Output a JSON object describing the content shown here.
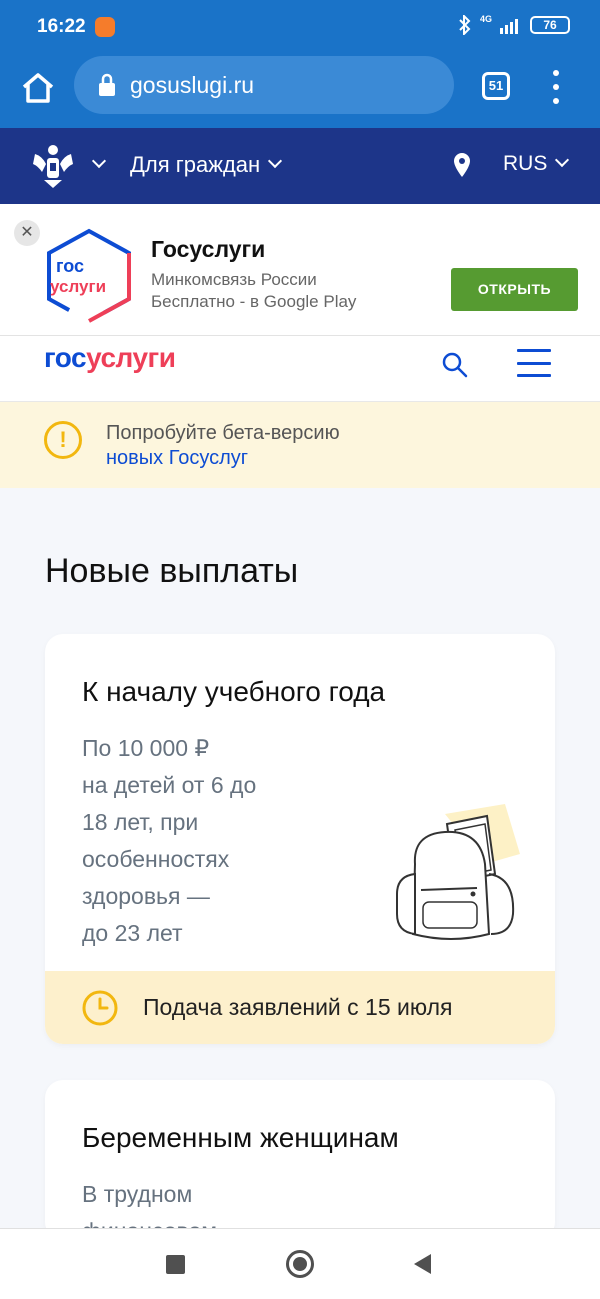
{
  "status_bar": {
    "time": "16:22",
    "network": "4G",
    "battery": "76"
  },
  "browser": {
    "url": "gosuslugi.ru",
    "tab_count": "51"
  },
  "gov_nav": {
    "citizens_label": "Для граждан",
    "language": "RUS"
  },
  "app_banner": {
    "logo_line1": "гос",
    "logo_line2": "услуги",
    "title": "Госуслуги",
    "publisher": "Минкомсвязь России",
    "price_store": "Бесплатно - в Google Play",
    "open_button": "ОТКРЫТЬ",
    "close_icon": "close-icon"
  },
  "site_header": {
    "logo_part1": "гос",
    "logo_part2": "услуги"
  },
  "beta_notice": {
    "line1": "Попробуйте бета-версию",
    "link": "новых Госуслуг"
  },
  "main": {
    "section_title": "Новые выплаты",
    "cards": [
      {
        "title": "К началу учебного года",
        "description_lines": [
          "По 10 000 ₽",
          "на детей от 6 до",
          "18 лет, при",
          "особенностях",
          "здоровья —",
          "до 23 лет"
        ],
        "footer": "Подача заявлений с 15 июля"
      },
      {
        "title": "Беременным женщинам",
        "description_lines": [
          "В трудном",
          "финансовом"
        ]
      }
    ]
  },
  "colors": {
    "browser_blue": "#1a73c8",
    "gov_navy": "#1d3589",
    "brand_blue": "#0d4cd3",
    "brand_red": "#ee3f58",
    "open_green": "#569b31",
    "warning_yellow": "#f2b70f"
  }
}
